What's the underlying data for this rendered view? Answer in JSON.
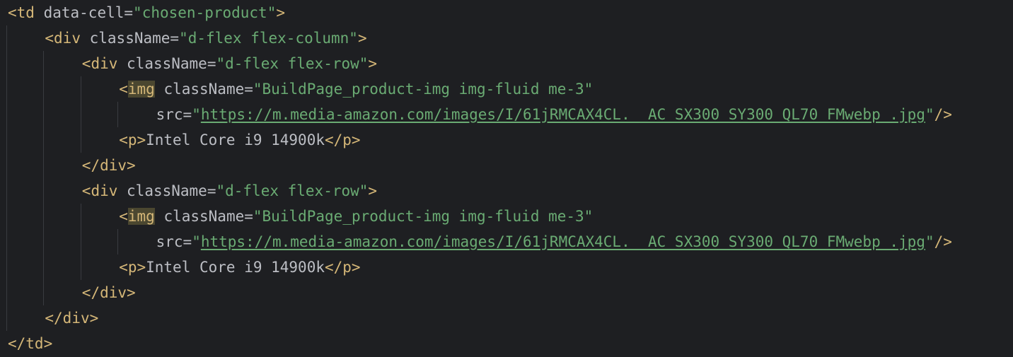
{
  "editor": {
    "lines": [
      {
        "indent": 0,
        "tokens": [
          {
            "t": "<td",
            "k": "tag"
          },
          {
            "t": " ",
            "k": "text"
          },
          {
            "t": "data-cell",
            "k": "attr"
          },
          {
            "t": "=",
            "k": "eq"
          },
          {
            "t": "\"chosen-product\"",
            "k": "str"
          },
          {
            "t": ">",
            "k": "tag"
          }
        ]
      },
      {
        "indent": 1,
        "tokens": [
          {
            "t": "<div",
            "k": "tag"
          },
          {
            "t": " ",
            "k": "text"
          },
          {
            "t": "className",
            "k": "attr"
          },
          {
            "t": "=",
            "k": "eq"
          },
          {
            "t": "\"d-flex flex-column\"",
            "k": "str"
          },
          {
            "t": ">",
            "k": "tag"
          }
        ]
      },
      {
        "indent": 2,
        "tokens": [
          {
            "t": "<div",
            "k": "tag"
          },
          {
            "t": " ",
            "k": "text"
          },
          {
            "t": "className",
            "k": "attr"
          },
          {
            "t": "=",
            "k": "eq"
          },
          {
            "t": "\"d-flex flex-row\"",
            "k": "str"
          },
          {
            "t": ">",
            "k": "tag"
          }
        ]
      },
      {
        "indent": 3,
        "tokens": [
          {
            "t": "<",
            "k": "tag"
          },
          {
            "t": "img",
            "k": "tag-hl"
          },
          {
            "t": " ",
            "k": "text"
          },
          {
            "t": "className",
            "k": "attr"
          },
          {
            "t": "=",
            "k": "eq"
          },
          {
            "t": "\"BuildPage_product-img img-fluid me-3\"",
            "k": "str"
          }
        ]
      },
      {
        "indent": 4,
        "tokens": [
          {
            "t": "src",
            "k": "attr"
          },
          {
            "t": "=",
            "k": "eq"
          },
          {
            "t": "\"",
            "k": "str"
          },
          {
            "t": "https://m.media-amazon.com/images/I/61jRMCAX4CL.__AC_SX300_SY300_QL70_FMwebp_.jpg",
            "k": "url"
          },
          {
            "t": "\"",
            "k": "str"
          },
          {
            "t": "/>",
            "k": "tag"
          }
        ]
      },
      {
        "indent": 3,
        "tokens": [
          {
            "t": "<p>",
            "k": "tag"
          },
          {
            "t": "Intel Core i9 14900k",
            "k": "text"
          },
          {
            "t": "</p>",
            "k": "tag"
          }
        ]
      },
      {
        "indent": 2,
        "tokens": [
          {
            "t": "</div>",
            "k": "tag"
          }
        ]
      },
      {
        "indent": 2,
        "tokens": [
          {
            "t": "<div",
            "k": "tag"
          },
          {
            "t": " ",
            "k": "text"
          },
          {
            "t": "className",
            "k": "attr"
          },
          {
            "t": "=",
            "k": "eq"
          },
          {
            "t": "\"d-flex flex-row\"",
            "k": "str"
          },
          {
            "t": ">",
            "k": "tag"
          }
        ]
      },
      {
        "indent": 3,
        "tokens": [
          {
            "t": "<",
            "k": "tag"
          },
          {
            "t": "img",
            "k": "tag-hl"
          },
          {
            "t": " ",
            "k": "text"
          },
          {
            "t": "className",
            "k": "attr"
          },
          {
            "t": "=",
            "k": "eq"
          },
          {
            "t": "\"BuildPage_product-img img-fluid me-3\"",
            "k": "str"
          }
        ]
      },
      {
        "indent": 4,
        "tokens": [
          {
            "t": "src",
            "k": "attr"
          },
          {
            "t": "=",
            "k": "eq"
          },
          {
            "t": "\"",
            "k": "str"
          },
          {
            "t": "https://m.media-amazon.com/images/I/61jRMCAX4CL.__AC_SX300_SY300_QL70_FMwebp_.jpg",
            "k": "url"
          },
          {
            "t": "\"",
            "k": "str"
          },
          {
            "t": "/>",
            "k": "tag"
          }
        ]
      },
      {
        "indent": 3,
        "tokens": [
          {
            "t": "<p>",
            "k": "tag"
          },
          {
            "t": "Intel Core i9 14900k",
            "k": "text"
          },
          {
            "t": "</p>",
            "k": "tag"
          }
        ]
      },
      {
        "indent": 2,
        "tokens": [
          {
            "t": "</div>",
            "k": "tag"
          }
        ]
      },
      {
        "indent": 1,
        "tokens": [
          {
            "t": "</div>",
            "k": "tag"
          }
        ]
      },
      {
        "indent": 0,
        "tokens": [
          {
            "t": "</td>",
            "k": "tag"
          }
        ]
      }
    ]
  },
  "colors": {
    "background": "#1e1f22",
    "tag": "#d5b778",
    "attribute": "#bcbec4",
    "string": "#6aab73",
    "text": "#bcbec4",
    "highlight": "#4b4730",
    "indent_guide": "#393b40"
  }
}
